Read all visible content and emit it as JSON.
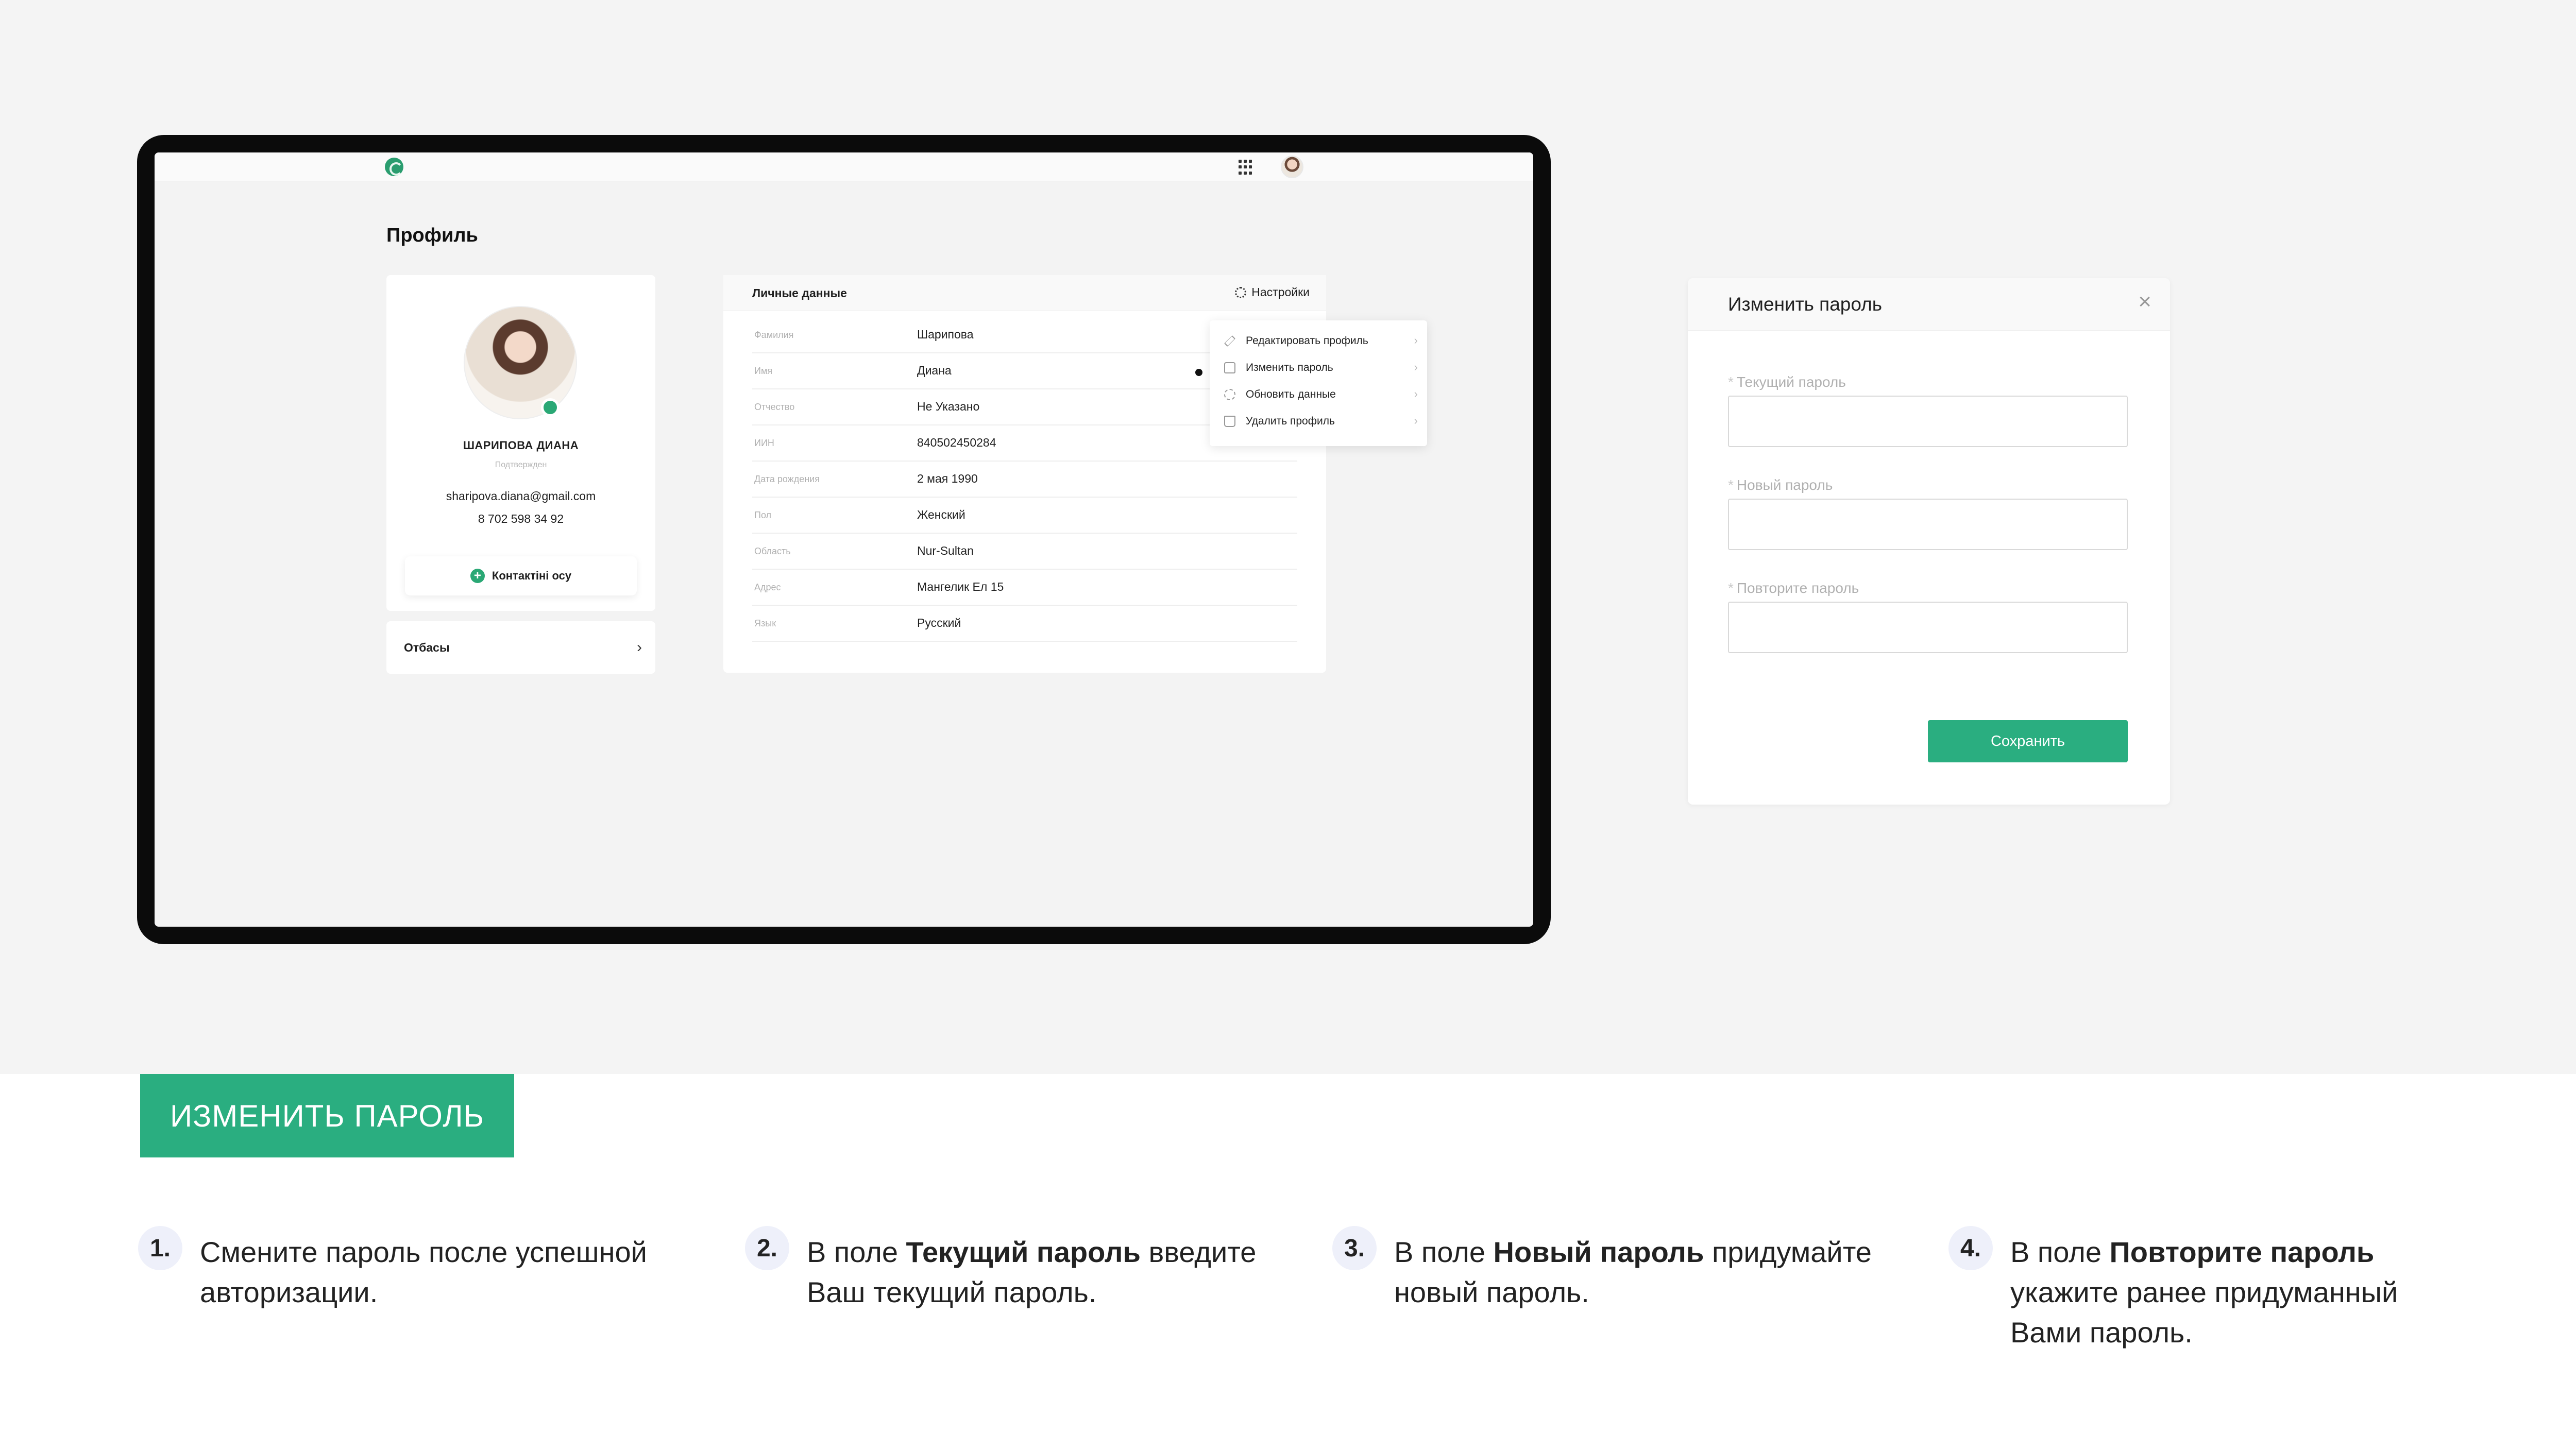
{
  "app": {
    "page_title": "Профиль",
    "profile": {
      "name": "ШАРИПОВА ДИАНА",
      "status": "Подтвержден",
      "email": "sharipova.diana@gmail.com",
      "phone": "8 702 598 34 92",
      "contact_button": "Контактіні осу"
    },
    "feedback": {
      "label": "Отбасы"
    },
    "personal": {
      "title": "Личные данные",
      "settings_label": "Настройки",
      "rows": [
        {
          "label": "Фамилия",
          "value": "Шарипова"
        },
        {
          "label": "Имя",
          "value": "Диана"
        },
        {
          "label": "Отчество",
          "value": "Не Указано"
        },
        {
          "label": "ИИН",
          "value": "840502450284"
        },
        {
          "label": "Дата рождения",
          "value": "2 мая 1990"
        },
        {
          "label": "Пол",
          "value": "Женский"
        },
        {
          "label": "Область",
          "value": "Nur-Sultan"
        },
        {
          "label": "Адрес",
          "value": "Мангелик Ел 15"
        },
        {
          "label": "Язык",
          "value": "Русский"
        }
      ]
    },
    "menu": [
      {
        "label": "Редактировать профиль",
        "icon": "pencil-icon"
      },
      {
        "label": "Изменить пароль",
        "icon": "lock-icon"
      },
      {
        "label": "Обновить данные",
        "icon": "refresh-icon"
      },
      {
        "label": "Удалить профиль",
        "icon": "trash-icon"
      }
    ]
  },
  "modal": {
    "title": "Изменить пароль",
    "required_mark": "*",
    "fields": [
      {
        "label": "Текущий пароль",
        "value": ""
      },
      {
        "label": "Новый пароль",
        "value": ""
      },
      {
        "label": "Повторите пароль",
        "value": ""
      }
    ],
    "save_label": "Сохранить"
  },
  "instructions": {
    "banner": "ИЗМЕНИТЬ ПАРОЛЬ",
    "steps": [
      {
        "num": "1.",
        "pre": "Смените пароль после успешной авторизации.",
        "bold": "",
        "post": ""
      },
      {
        "num": "2.",
        "pre": "В поле ",
        "bold": "Текущий пароль",
        "post": " введите Ваш текущий пароль."
      },
      {
        "num": "3.",
        "pre": "В поле ",
        "bold": "Новый пароль",
        "post": " придумайте новый пароль."
      },
      {
        "num": "4.",
        "pre": "В поле ",
        "bold": "Повторите пароль",
        "post": " укажите ранее придуманный Вами пароль."
      }
    ]
  },
  "colors": {
    "accent": "#2aae80",
    "tablet_frame": "#0b0b0b",
    "background": "#f4f4f4"
  }
}
